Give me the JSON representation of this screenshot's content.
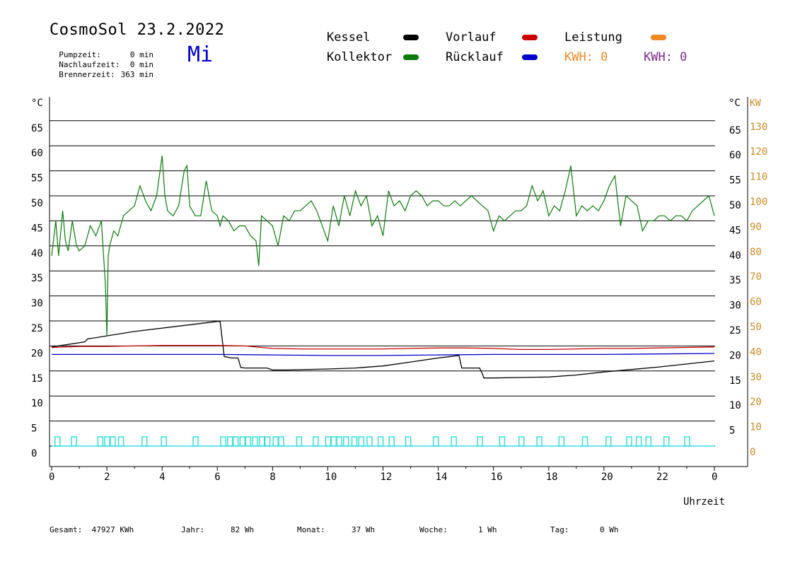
{
  "header": {
    "title": "CosmoSol 23.2.2022",
    "day": "Mi",
    "pumpzeit_label": "Pumpzeit:",
    "pumpzeit_value": "0 min",
    "nachlaufzeit_label": "Nachlaufzeit:",
    "nachlaufzeit_value": "0 min",
    "brennerzeit_label": "Brennerzeit:",
    "brennerzeit_value": "363 min"
  },
  "legend": {
    "kessel": "Kessel",
    "kollektor": "Kollektor",
    "vorlauf": "Vorlauf",
    "ruecklauf": "Rücklauf",
    "leistung": "Leistung",
    "kwh1": "KWH: 0",
    "kwh2": "KWH: 0"
  },
  "colors": {
    "kessel": "#000000",
    "kollektor": "#0a7a0a",
    "vorlauf": "#cc0000",
    "ruecklauf": "#0000cc",
    "leistung": "#ee8822",
    "kwh2": "#7a2a8a",
    "pump": "#33dddd",
    "axis_right_kw": "#cc8a22"
  },
  "footer": {
    "gesamt_label": "Gesamt:",
    "gesamt_value": "47927 KWh",
    "jahr_label": "Jahr:",
    "jahr_value": "82 Wh",
    "monat_label": "Monat:",
    "monat_value": "37 Wh",
    "woche_label": "Woche:",
    "woche_value": "1 Wh",
    "tag_label": "Tag:",
    "tag_value": "0 Wh"
  },
  "chart_data": {
    "type": "line",
    "xlabel": "Uhrzeit",
    "ylabel_left": "°C",
    "ylabel_right": "°C",
    "ylabel_right2": "KW",
    "xlim": [
      0,
      24
    ],
    "ylim": [
      -3,
      69
    ],
    "x_ticks": [
      "0",
      "2",
      "4",
      "6",
      "8",
      "10",
      "12",
      "14",
      "16",
      "18",
      "20",
      "22",
      "0"
    ],
    "y_ticks_left": [
      "0",
      "5",
      "10",
      "15",
      "20",
      "25",
      "30",
      "35",
      "40",
      "45",
      "50",
      "55",
      "60",
      "65"
    ],
    "y_ticks_right": [
      "5",
      "10",
      "15",
      "20",
      "25",
      "30",
      "35",
      "40",
      "45",
      "50",
      "55",
      "60",
      "65"
    ],
    "y_ticks_right_kw": [
      "0",
      "10",
      "20",
      "30",
      "40",
      "50",
      "60",
      "70",
      "80",
      "90",
      "100",
      "110",
      "120",
      "130"
    ],
    "grid": true,
    "series": [
      {
        "name": "Kessel",
        "x": [
          0,
          1.2,
          1.3,
          3.0,
          6.0,
          6.1,
          6.25,
          6.5,
          6.75,
          6.85,
          7.0,
          7.8,
          8.0,
          8.5,
          10.0,
          11.0,
          12.0,
          13.0,
          14.0,
          14.75,
          14.85,
          15.3,
          15.5,
          15.6,
          15.65,
          16.0,
          17.0,
          18.0,
          19.0,
          20.0,
          21.0,
          22.0,
          23.0,
          24.0
        ],
        "y": [
          19.8,
          20.8,
          21.4,
          22.9,
          24.9,
          24.9,
          17.9,
          17.6,
          17.6,
          15.7,
          15.6,
          15.6,
          15.2,
          15.2,
          15.4,
          15.6,
          16.0,
          16.8,
          17.6,
          18.1,
          15.6,
          15.6,
          15.6,
          14.4,
          13.6,
          13.6,
          13.7,
          13.8,
          14.2,
          14.8,
          15.3,
          15.8,
          16.4,
          17.0
        ]
      },
      {
        "name": "Vorlauf",
        "x": [
          0,
          1,
          2,
          3,
          4,
          5,
          6,
          7,
          8,
          9,
          10,
          11,
          12,
          13,
          14,
          15,
          16,
          17,
          18,
          19,
          20,
          21,
          22,
          23,
          24
        ],
        "y": [
          19.7,
          19.9,
          19.9,
          20.0,
          20.1,
          20.1,
          20.1,
          20.0,
          19.5,
          19.4,
          19.4,
          19.4,
          19.4,
          19.5,
          19.6,
          19.6,
          19.5,
          19.3,
          19.3,
          19.4,
          19.5,
          19.5,
          19.6,
          19.7,
          19.8
        ]
      },
      {
        "name": "Rücklauf",
        "x": [
          0,
          2,
          4,
          6,
          8,
          10,
          12,
          14,
          16,
          18,
          20,
          22,
          24
        ],
        "y": [
          18.3,
          18.3,
          18.3,
          18.3,
          18.2,
          18.1,
          18.1,
          18.2,
          18.3,
          18.3,
          18.3,
          18.4,
          18.5
        ]
      },
      {
        "name": "Kollektor",
        "x": [
          0,
          0.15,
          0.25,
          0.4,
          0.5,
          0.6,
          0.75,
          0.9,
          1.0,
          1.2,
          1.4,
          1.6,
          1.8,
          1.95,
          2.0,
          2.05,
          2.1,
          2.25,
          2.4,
          2.6,
          2.8,
          3.0,
          3.2,
          3.4,
          3.6,
          3.8,
          4.0,
          4.1,
          4.2,
          4.4,
          4.6,
          4.8,
          4.9,
          5.0,
          5.2,
          5.4,
          5.6,
          5.8,
          6.0,
          6.1,
          6.2,
          6.4,
          6.6,
          6.8,
          7.0,
          7.2,
          7.4,
          7.5,
          7.6,
          7.8,
          8.0,
          8.2,
          8.4,
          8.6,
          8.8,
          9.0,
          9.2,
          9.4,
          9.6,
          9.8,
          10.0,
          10.2,
          10.4,
          10.6,
          10.8,
          11.0,
          11.2,
          11.4,
          11.6,
          11.8,
          12.0,
          12.2,
          12.4,
          12.6,
          12.8,
          13.0,
          13.2,
          13.4,
          13.6,
          13.8,
          14.0,
          14.2,
          14.4,
          14.6,
          14.8,
          15.0,
          15.2,
          15.4,
          15.6,
          15.8,
          16.0,
          16.2,
          16.4,
          16.6,
          16.8,
          17.0,
          17.2,
          17.4,
          17.6,
          17.8,
          18.0,
          18.2,
          18.4,
          18.6,
          18.8,
          19.0,
          19.2,
          19.4,
          19.6,
          19.8,
          20.0,
          20.2,
          20.4,
          20.6,
          20.8,
          21.0,
          21.2,
          21.4,
          21.6,
          21.8,
          22.0,
          22.2,
          22.4,
          22.6,
          22.8,
          23.0,
          23.2,
          23.4,
          23.6,
          23.8,
          24.0
        ],
        "y": [
          38,
          45,
          38,
          47,
          41,
          39,
          45,
          40,
          39,
          40,
          44,
          42,
          45,
          32,
          22,
          38,
          40,
          43,
          42,
          46,
          47,
          48,
          52,
          49,
          47,
          50,
          58,
          50,
          47,
          46,
          48,
          55,
          56,
          48,
          46,
          46,
          53,
          47,
          46,
          44,
          46,
          45,
          43,
          44,
          44,
          42,
          41,
          36,
          46,
          45,
          44,
          40,
          46,
          45,
          47,
          47,
          48,
          49,
          47,
          44,
          41,
          48,
          44,
          50,
          46,
          51,
          48,
          50,
          44,
          46,
          42,
          51,
          48,
          49,
          47,
          50,
          51,
          50,
          48,
          49,
          49,
          48,
          48,
          49,
          48,
          49,
          50,
          49,
          48,
          47,
          43,
          46,
          45,
          46,
          47,
          47,
          48,
          52,
          49,
          51,
          46,
          48,
          47,
          51,
          56,
          46,
          48,
          47,
          48,
          47,
          49,
          52,
          54,
          44,
          50,
          49,
          48,
          43,
          45,
          45,
          46,
          46,
          45,
          46,
          46,
          45,
          47,
          48,
          49,
          50,
          46
        ]
      },
      {
        "name": "Pumpe",
        "x": [
          0.2,
          0.8,
          1.75,
          2.0,
          2.2,
          2.5,
          3.35,
          4.05,
          5.2,
          6.2,
          6.45,
          6.65,
          6.9,
          7.1,
          7.35,
          7.6,
          7.8,
          8.1,
          8.3,
          8.95,
          9.55,
          10.0,
          10.2,
          10.4,
          10.65,
          10.95,
          11.2,
          11.5,
          11.9,
          12.3,
          12.9,
          13.9,
          14.55,
          15.5,
          16.3,
          17.0,
          17.65,
          18.45,
          19.3,
          20.15,
          20.9,
          21.25,
          21.6,
          22.25,
          23.0
        ],
        "y": [
          0,
          0,
          0,
          0,
          0,
          0,
          0,
          0,
          0,
          0,
          0,
          0,
          0,
          0,
          0,
          0,
          0,
          0,
          0,
          0,
          0,
          0,
          0,
          0,
          0,
          0,
          0,
          0,
          0,
          0,
          0,
          0,
          0,
          0,
          0,
          0,
          0,
          0,
          0,
          0,
          0,
          0,
          0,
          0,
          0
        ]
      }
    ]
  }
}
